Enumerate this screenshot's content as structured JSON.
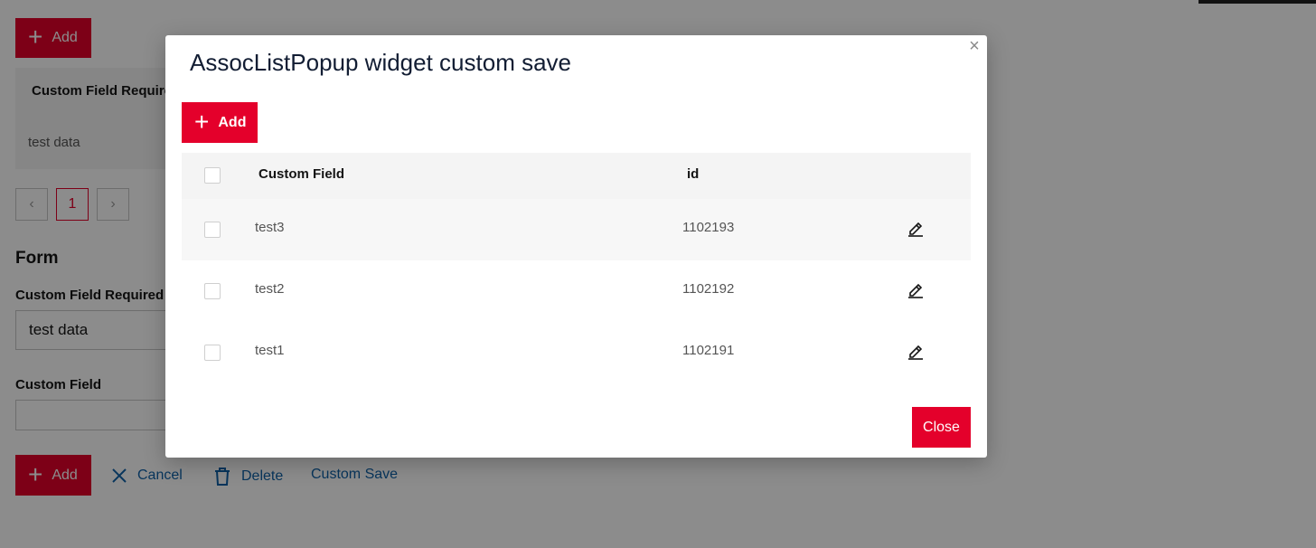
{
  "background": {
    "top_add_label": "Add",
    "table_header": "Custom Field Require",
    "table_cell": "test data",
    "pagination": {
      "prev": "‹",
      "page": "1",
      "next": "›"
    },
    "form_title": "Form",
    "field1_label": "Custom Field Required",
    "field1_value": "test data",
    "field2_label": "Custom Field",
    "field2_value": "",
    "actions": {
      "add": "Add",
      "cancel": "Cancel",
      "delete": "Delete",
      "custom_save": "Custom Save"
    }
  },
  "modal": {
    "title": "AssocListPopup widget custom save",
    "close_x": "×",
    "add_label": "Add",
    "columns": [
      "Custom Field",
      "id"
    ],
    "rows": [
      {
        "custom_field": "test3",
        "id": "1102193"
      },
      {
        "custom_field": "test2",
        "id": "1102192"
      },
      {
        "custom_field": "test1",
        "id": "1102191"
      }
    ],
    "close_label": "Close"
  },
  "colors": {
    "primary": "#e4002b",
    "link": "#0f62a8",
    "title": "#121d33"
  },
  "icons": [
    "plus-icon",
    "cancel-x-icon",
    "trash-icon",
    "pencil-edit-icon",
    "close-icon"
  ]
}
